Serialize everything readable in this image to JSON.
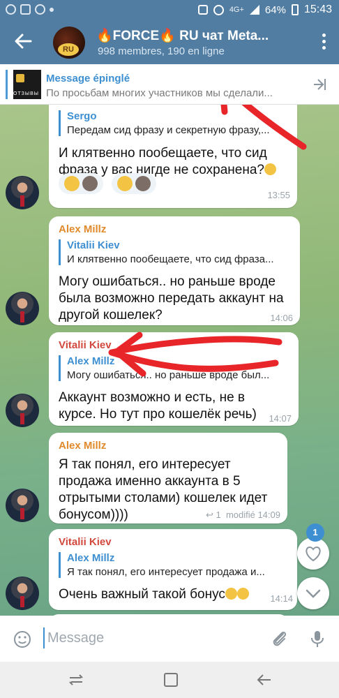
{
  "status": {
    "signal": "4G+",
    "battery": "64%",
    "time": "15:43"
  },
  "header": {
    "title": "🔥FORCE🔥 RU чат Meta...",
    "subtitle": "998 membres, 190 en ligne",
    "avatar_text": "RU"
  },
  "pinned": {
    "label": "Message épinglé",
    "text": "По просьбам многих участников мы сделали...",
    "thumb_text": "ОТЗЫВЫ"
  },
  "messages": [
    {
      "reply_name": "Sergo",
      "reply_text": "Передам сид фразу и секретную фразу,...",
      "text_lines": [
        "И клятвенно пообещаете, что сид",
        "фраза у вас нигде не сохранена?"
      ],
      "time": "13:55"
    },
    {
      "author": "Alex Millz",
      "reply_name": "Vitalii Kiev",
      "reply_text": "И клятвенно пообещаете, что сид фраза...",
      "text_lines": [
        "Могу ошибаться.. но раньше вроде",
        "была возможно передать аккаунт на",
        "другой кошелек?"
      ],
      "time": "14:06"
    },
    {
      "author": "Vitalii Kiev",
      "reply_name": "Alex Millz",
      "reply_text": "Могу ошибаться.. но раньше вроде был...",
      "text_lines": [
        "Аккаунт возможно и есть, не в",
        "курсе. Но тут про кошелёк речь)"
      ],
      "time": "14:07"
    },
    {
      "author": "Alex Millz",
      "text_lines": [
        "Я так понял, его интересует",
        "продажа именно аккаунта в 5",
        "отрытыми столами) кошелек  идет",
        "бонусом))))"
      ],
      "replies": "1",
      "time": "modifié 14:09"
    },
    {
      "author": "Vitalii Kiev",
      "reply_name": "Alex Millz",
      "reply_text": "Я так понял, его интересует   продажа и...",
      "text_lines": [
        "Очень важный такой бонус"
      ],
      "time": "14:14"
    }
  ],
  "fab": {
    "badge": "1"
  },
  "input": {
    "placeholder": "Message"
  },
  "colors": {
    "header": "#517da2",
    "link": "#3d8fd1",
    "alex": "#e08a2c",
    "vitalii": "#d2483c",
    "annotation": "#e8262a"
  }
}
